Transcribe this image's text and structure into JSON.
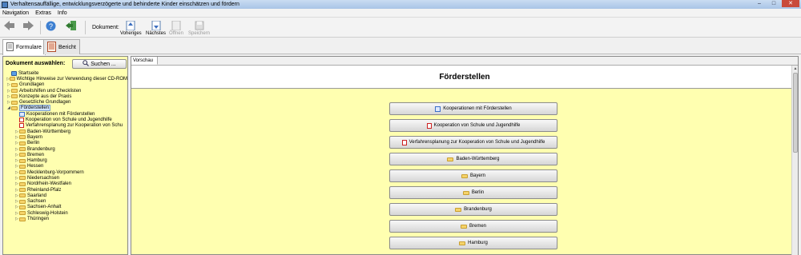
{
  "window": {
    "title": "Verhaltensauffällige, entwicklungsverzögerte und behinderte Kinder einschätzen und fördern",
    "buttons": [
      "–",
      "□",
      "✕"
    ]
  },
  "menu": [
    "Navigation",
    "Extras",
    "Info"
  ],
  "toolbar": {
    "back_icon": "arrow-left-icon",
    "forward_icon": "arrow-right-icon",
    "help_icon": "help-icon",
    "exit_icon": "exit-icon",
    "document_label": "Dokument:",
    "previous_label": "Voheriges",
    "next_label": "Nächstes",
    "open_label": "Öffnen",
    "save_label": "Speichern"
  },
  "tabs": [
    {
      "label": "Formulare",
      "icon": "forms-icon",
      "active": true
    },
    {
      "label": "Bericht",
      "icon": "report-icon",
      "active": false
    }
  ],
  "left_panel": {
    "header": "Dokument auswählen:",
    "search_label": "Suchen ..."
  },
  "tree": [
    {
      "label": "Startseite",
      "icon": "home",
      "level": 0,
      "expander": ""
    },
    {
      "label": "Wichtige Hinweise zur Verwendung dieser CD-ROM",
      "icon": "folder",
      "level": 0,
      "expander": "▷"
    },
    {
      "label": "Grundlagen",
      "icon": "folder",
      "level": 0,
      "expander": "▷"
    },
    {
      "label": "Arbeitshilfen und Checklisten",
      "icon": "folder",
      "level": 0,
      "expander": "▷"
    },
    {
      "label": "Konzepte aus der Praxis",
      "icon": "folder",
      "level": 0,
      "expander": "▷"
    },
    {
      "label": "Gesetzliche Grundlagen",
      "icon": "folder",
      "level": 0,
      "expander": "▷"
    },
    {
      "label": "Förderstellen",
      "icon": "folder",
      "level": 0,
      "expander": "◢",
      "selected": true
    },
    {
      "label": "Kooperationen mit Förderstellen",
      "icon": "doc",
      "level": 1,
      "expander": ""
    },
    {
      "label": "Kooperation von Schule und Jugendhilfe",
      "icon": "pdf",
      "level": 1,
      "expander": ""
    },
    {
      "label": "Verfahrensplanung zur Kooperation von Schu",
      "icon": "pdf",
      "level": 1,
      "expander": ""
    },
    {
      "label": "Baden-Württemberg",
      "icon": "folder",
      "level": 1,
      "expander": "▷"
    },
    {
      "label": "Bayern",
      "icon": "folder",
      "level": 1,
      "expander": "▷"
    },
    {
      "label": "Berlin",
      "icon": "folder",
      "level": 1,
      "expander": "▷"
    },
    {
      "label": "Brandenburg",
      "icon": "folder",
      "level": 1,
      "expander": "▷"
    },
    {
      "label": "Bremen",
      "icon": "folder",
      "level": 1,
      "expander": "▷"
    },
    {
      "label": "Hamburg",
      "icon": "folder",
      "level": 1,
      "expander": "▷"
    },
    {
      "label": "Hessen",
      "icon": "folder",
      "level": 1,
      "expander": "▷"
    },
    {
      "label": "Mecklenburg-Vorpommern",
      "icon": "folder",
      "level": 1,
      "expander": "▷"
    },
    {
      "label": "Niedersachsen",
      "icon": "folder",
      "level": 1,
      "expander": "▷"
    },
    {
      "label": "Nordrhein-Westfalen",
      "icon": "folder",
      "level": 1,
      "expander": "▷"
    },
    {
      "label": "Rheinland-Pfalz",
      "icon": "folder",
      "level": 1,
      "expander": "▷"
    },
    {
      "label": "Saarland",
      "icon": "folder",
      "level": 1,
      "expander": "▷"
    },
    {
      "label": "Sachsen",
      "icon": "folder",
      "level": 1,
      "expander": "▷"
    },
    {
      "label": "Sachsen-Anhalt",
      "icon": "folder",
      "level": 1,
      "expander": "▷"
    },
    {
      "label": "Schleswig-Holstein",
      "icon": "folder",
      "level": 1,
      "expander": "▷"
    },
    {
      "label": "Thüringen",
      "icon": "folder",
      "level": 1,
      "expander": "▷"
    }
  ],
  "preview": {
    "tab_label": "Vorschau",
    "title": "Förderstellen",
    "buttons": [
      {
        "label": "Kooperationen mit Förderstellen",
        "icon": "doc"
      },
      {
        "label": "Kooperation von Schule und Jugendhilfe",
        "icon": "pdf"
      },
      {
        "label": "Verfahrensplanung zur Kooperation von Schule und Jugendhilfe",
        "icon": "pdf"
      },
      {
        "label": "Baden-Württemberg",
        "icon": "folder"
      },
      {
        "label": "Bayern",
        "icon": "folder"
      },
      {
        "label": "Berlin",
        "icon": "folder"
      },
      {
        "label": "Brandenburg",
        "icon": "folder"
      },
      {
        "label": "Bremen",
        "icon": "folder"
      },
      {
        "label": "Hamburg",
        "icon": "folder"
      }
    ]
  },
  "colors": {
    "panel_bg": "#ffffb0",
    "titlebar": "#b9d1ee"
  }
}
